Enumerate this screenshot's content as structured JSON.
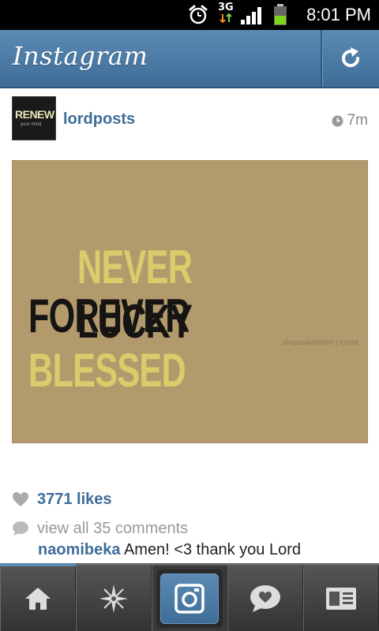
{
  "status_bar": {
    "network": "3G",
    "time": "8:01 PM",
    "icons": [
      "alarm-icon",
      "data-arrows-icon",
      "signal-icon",
      "battery-icon"
    ]
  },
  "header": {
    "app_title": "Instagram",
    "refresh_icon": "refresh-icon"
  },
  "post": {
    "username": "lordposts",
    "time_ago": "7m",
    "avatar_text_1": "RENEW",
    "avatar_text_2": "your mind",
    "image_text": {
      "word1": "NEVER",
      "word2": "LUCKY",
      "word3": "FOREVER",
      "word4": "BLESSED",
      "credit": "akopasikathleen | tumblr"
    },
    "likes": "3771 likes",
    "view_comments": "view all 35 comments",
    "comment_user": "naomibeka",
    "comment_text": "Amen! <3 thank you Lord"
  },
  "nav": {
    "items": [
      {
        "icon": "home-icon"
      },
      {
        "icon": "explore-icon"
      },
      {
        "icon": "camera-icon"
      },
      {
        "icon": "news-heart-icon"
      },
      {
        "icon": "profile-card-icon"
      }
    ]
  },
  "colors": {
    "brand": "#3e6d98",
    "header_top": "#5b8ab3",
    "image_bg": "#b29a6d",
    "text_yellow": "#dccb6b"
  }
}
